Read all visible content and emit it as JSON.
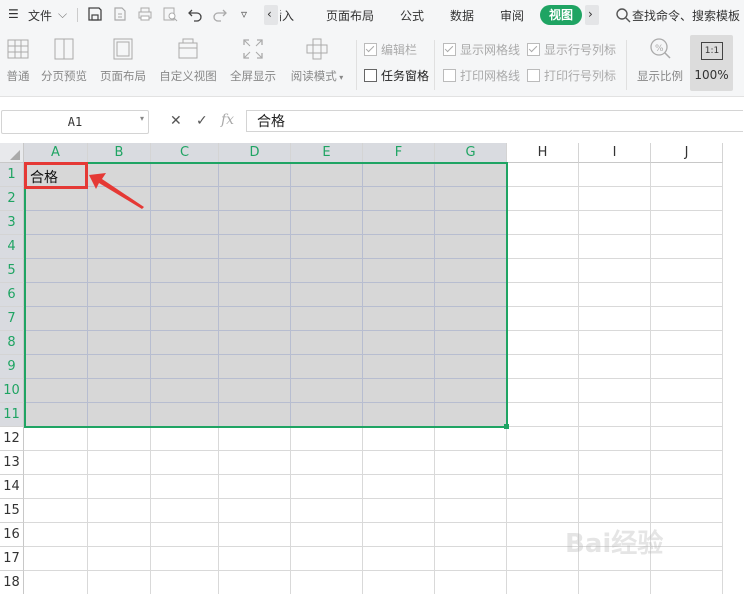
{
  "menubar": {
    "file_label": "文件",
    "tabs": [
      "插入",
      "页面布局",
      "公式",
      "数据",
      "审阅"
    ],
    "active_tab": "视图",
    "search_placeholder": "查找命令、搜索模板"
  },
  "ribbon": {
    "buttons": [
      "普通",
      "分页预览",
      "页面布局",
      "自定义视图",
      "全屏显示",
      "阅读模式"
    ],
    "checkboxes": {
      "edit_bar": "编辑栏",
      "task_pane": "任务窗格",
      "show_gridlines": "显示网格线",
      "print_gridlines": "打印网格线",
      "show_headers": "显示行号列标",
      "print_headers": "打印行号列标"
    },
    "zoom_ratio_label": "显示比例",
    "zoom_value": "100%",
    "zoom_icon_text": "1:1"
  },
  "formula_bar": {
    "name_box": "A1",
    "cancel_glyph": "✕",
    "confirm_glyph": "✓",
    "fx_glyph": "fx",
    "content": "合格"
  },
  "sheet": {
    "columns": [
      "A",
      "B",
      "C",
      "D",
      "E",
      "F",
      "G",
      "H",
      "I",
      "J"
    ],
    "rows": [
      "1",
      "2",
      "3",
      "4",
      "5",
      "6",
      "7",
      "8",
      "9",
      "10",
      "11",
      "12",
      "13",
      "14",
      "15",
      "16",
      "17",
      "18"
    ],
    "a1_value": "合格",
    "selected_range": "A1:G11"
  },
  "colors": {
    "accent": "#1fa463",
    "annotation": "#e53935",
    "selection_fill": "#d7d7d7"
  }
}
